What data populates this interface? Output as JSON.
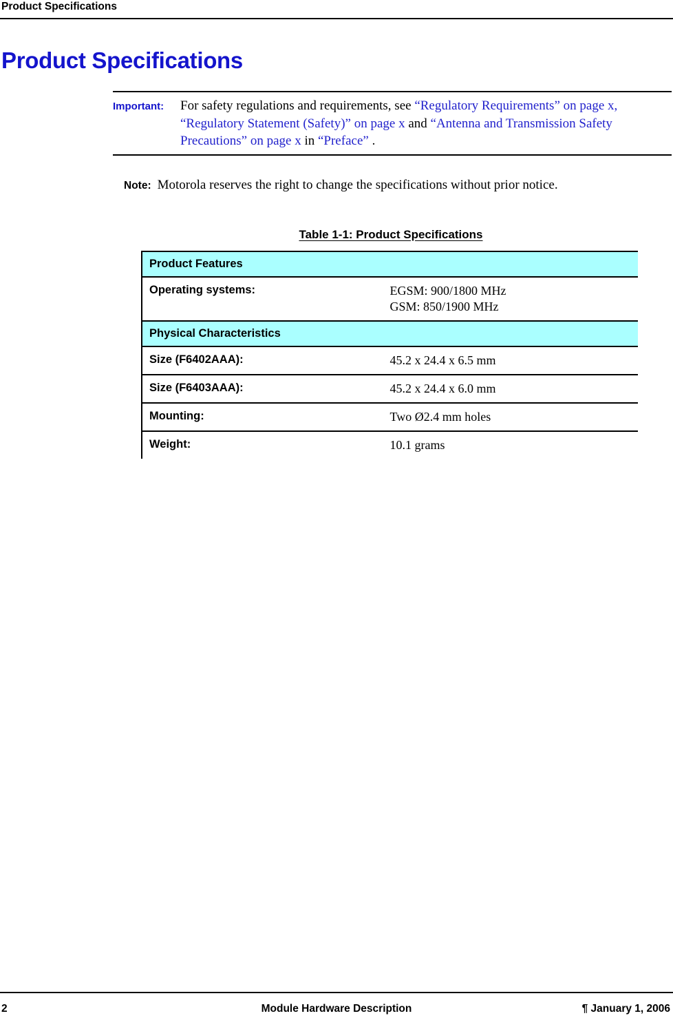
{
  "header": {
    "running_head": "Product Specifications"
  },
  "chapter": {
    "title": "Product Specifications"
  },
  "important": {
    "label": "Important:",
    "text_part_1": "For safety regulations and requirements, see ",
    "xref_1": "“Regulatory Requirements” on page x,",
    "text_part_2": " ",
    "xref_2": "“Regulatory Statement (Safety)” on page x",
    "text_part_3": " and ",
    "xref_3": "“Antenna and Transmission Safety Precautions” on page x",
    "text_part_4": " in ",
    "xref_4": "“Preface”",
    "text_part_5": " ."
  },
  "note": {
    "label": "Note:",
    "text": "Motorola reserves the right to change the specifications without prior notice."
  },
  "table": {
    "caption": "Table 1-1: Product Specifications ",
    "section_header_color": "#aaffff",
    "rows": [
      {
        "kind": "section",
        "label": "Product Features",
        "value": ""
      },
      {
        "kind": "data",
        "label": "Operating systems:",
        "value": "EGSM: 900/1800 MHz\nGSM: 850/1900 MHz"
      },
      {
        "kind": "section",
        "label": "Physical Characteristics",
        "value": ""
      },
      {
        "kind": "data",
        "label": "Size (F6402AAA):",
        "value": "45.2 x 24.4 x 6.5 mm"
      },
      {
        "kind": "data",
        "label": "Size (F6403AAA):",
        "value": "45.2 x 24.4 x 6.0 mm"
      },
      {
        "kind": "data",
        "label": "Mounting:",
        "value": "Two Ø2.4 mm holes"
      },
      {
        "kind": "data",
        "label": "Weight:",
        "value": "10.1 grams"
      }
    ]
  },
  "footer": {
    "page_number": "2",
    "center_text": "Module Hardware Description",
    "date_text": "¶ January 1, 2006"
  },
  "colors": {
    "heading_blue": "#1414cc",
    "xref_blue": "#2222cc",
    "section_cyan": "#aaffff",
    "rule_black": "#000000"
  }
}
